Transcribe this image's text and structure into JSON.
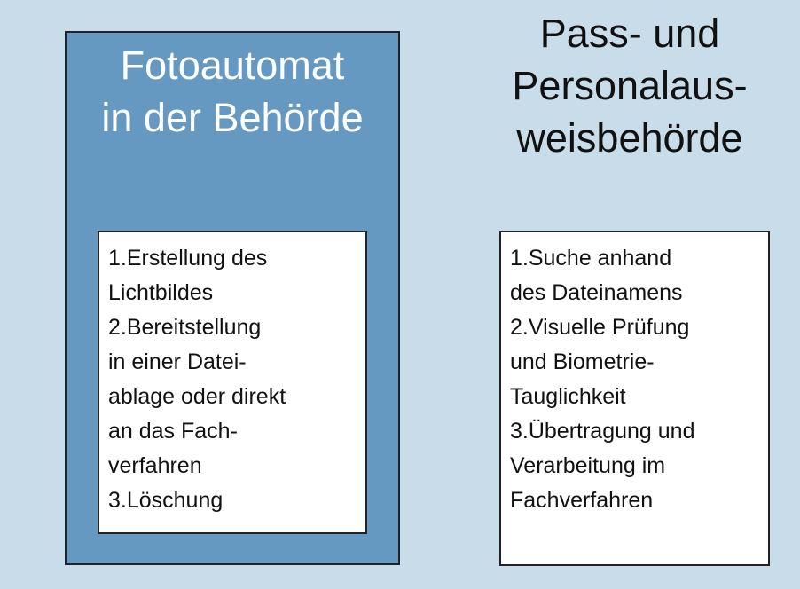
{
  "colors": {
    "background": "#c9dcea",
    "left_panel": "#6699c2",
    "box_fill": "#ffffff",
    "border": "#222222"
  },
  "left": {
    "title": "Fotoautomat\nin der Behörde",
    "lines": [
      "1.Erstellung des",
      "Lichtbildes",
      "2.Bereitstellung",
      "in einer Datei-",
      "ablage oder direkt",
      "an das Fach-",
      "verfahren",
      "3.Löschung"
    ]
  },
  "right": {
    "title": "Pass- und\nPersonalaus-\nweisbehörde",
    "lines": [
      "1.Suche anhand",
      "des Dateinamens",
      "2.Visuelle Prüfung",
      "und Biometrie-",
      "Tauglichkeit",
      "3.Übertragung und",
      "Verarbeitung im",
      "Fachverfahren"
    ]
  }
}
